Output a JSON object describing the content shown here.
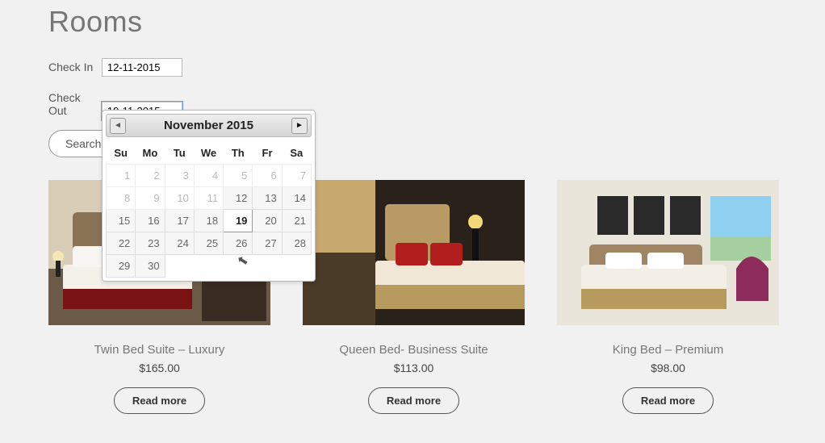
{
  "page": {
    "title": "Rooms"
  },
  "form": {
    "checkin_label": "Check In",
    "checkin_value": "12-11-2015",
    "checkout_label": "Check Out",
    "checkout_value": "19-11-2015",
    "search_label": "Search"
  },
  "datepicker": {
    "month_label": "November 2015",
    "dow": [
      "Su",
      "Mo",
      "Tu",
      "We",
      "Th",
      "Fr",
      "Sa"
    ],
    "weeks": [
      [
        {
          "n": 1,
          "d": true
        },
        {
          "n": 2,
          "d": true
        },
        {
          "n": 3,
          "d": true
        },
        {
          "n": 4,
          "d": true
        },
        {
          "n": 5,
          "d": true
        },
        {
          "n": 6,
          "d": true
        },
        {
          "n": 7,
          "d": true
        }
      ],
      [
        {
          "n": 8,
          "d": true
        },
        {
          "n": 9,
          "d": true
        },
        {
          "n": 10,
          "d": true
        },
        {
          "n": 11,
          "d": true
        },
        {
          "n": 12
        },
        {
          "n": 13
        },
        {
          "n": 14
        }
      ],
      [
        {
          "n": 15
        },
        {
          "n": 16
        },
        {
          "n": 17
        },
        {
          "n": 18
        },
        {
          "n": 19,
          "sel": true
        },
        {
          "n": 20
        },
        {
          "n": 21
        }
      ],
      [
        {
          "n": 22
        },
        {
          "n": 23
        },
        {
          "n": 24
        },
        {
          "n": 25
        },
        {
          "n": 26
        },
        {
          "n": 27
        },
        {
          "n": 28
        }
      ],
      [
        {
          "n": 29
        },
        {
          "n": 30
        },
        {
          "e": true
        },
        {
          "e": true
        },
        {
          "e": true
        },
        {
          "e": true
        },
        {
          "e": true
        }
      ]
    ]
  },
  "rooms": [
    {
      "title": "Twin Bed Suite – Luxury",
      "price": "$165.00",
      "cta": "Read more"
    },
    {
      "title": "Queen Bed- Business Suite",
      "price": "$113.00",
      "cta": "Read more"
    },
    {
      "title": "King Bed – Premium",
      "price": "$98.00",
      "cta": "Read more"
    }
  ]
}
